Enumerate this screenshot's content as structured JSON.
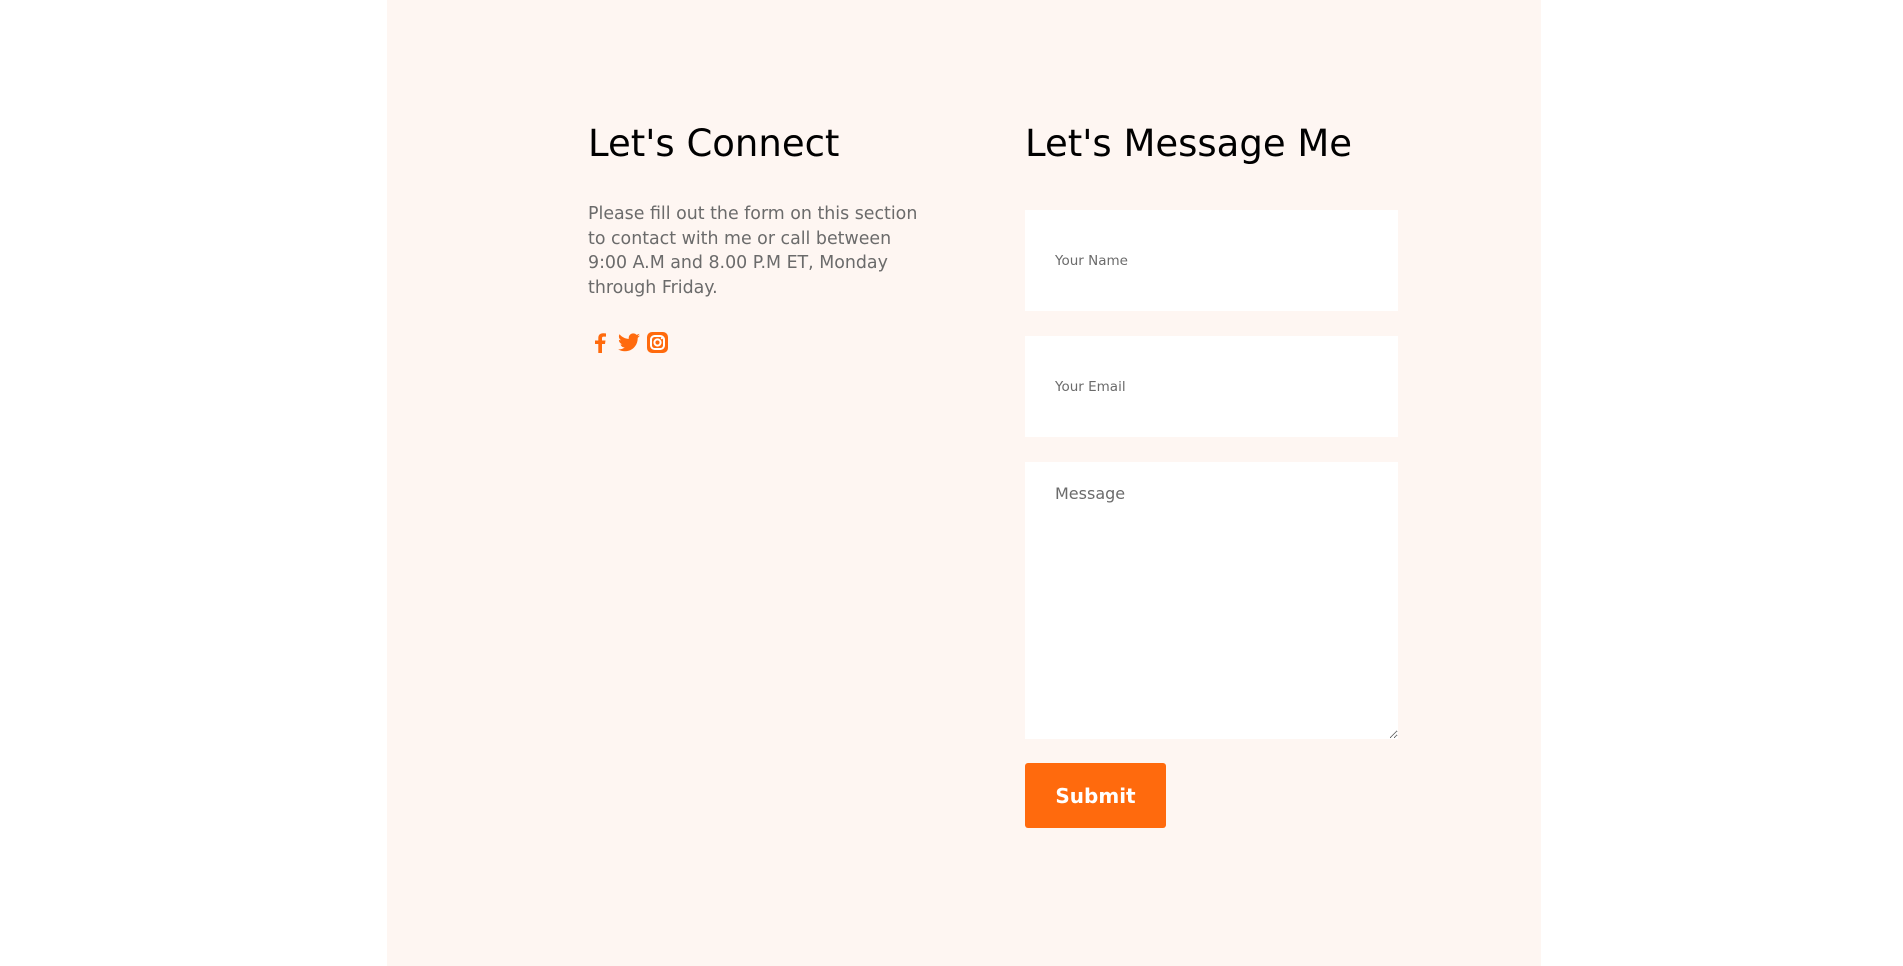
{
  "colors": {
    "accent": "#ff6a0d",
    "panel_bg": "#fef6f2",
    "heading": "#000000",
    "body_text": "#6b6b6b",
    "field_bg": "#ffffff"
  },
  "connect": {
    "title": "Let's Connect",
    "description": "Please fill out the form on this section to contact with me or call between 9:00 A.M and 8.00 P.M ET, Monday through Friday.",
    "social_icons": [
      "facebook-icon",
      "twitter-icon",
      "instagram-icon"
    ]
  },
  "message": {
    "title": "Let's Message Me",
    "name_field": {
      "placeholder": "Your Name",
      "value": ""
    },
    "email_field": {
      "placeholder": "Your Email",
      "value": ""
    },
    "message_field": {
      "placeholder": "Message",
      "value": ""
    },
    "submit_label": "Submit"
  }
}
